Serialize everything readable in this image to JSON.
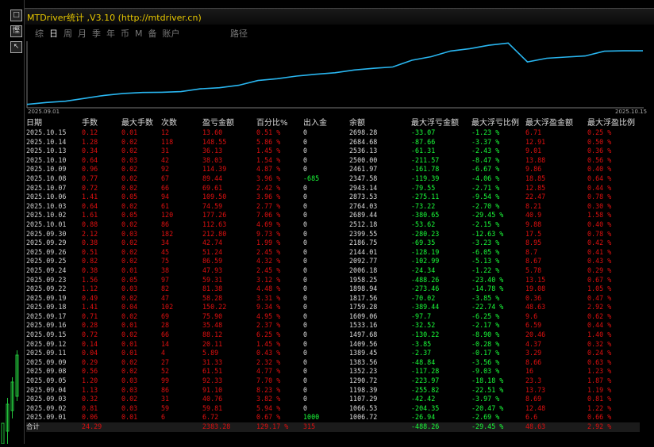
{
  "app": {
    "title": "MTDriver统计 ,V3.10 (http://mtdriver.cn)",
    "left_buttons": [
      "□",
      "慳",
      "↖"
    ]
  },
  "tabs": [
    "综",
    "日",
    "周",
    "月",
    "季",
    "年",
    "币",
    "M",
    "备",
    "账户"
  ],
  "active_tab": 1,
  "path_label": "路径",
  "equity_chart": {
    "type": "line",
    "line_color": "#29b6f0",
    "x_start_label": "2025.09.01",
    "x_end_label": "2025.10.15",
    "x": [
      "2025.09.01",
      "2025.09.02",
      "2025.09.03",
      "2025.09.04",
      "2025.09.05",
      "2025.09.08",
      "2025.09.09",
      "2025.09.10",
      "2025.09.11",
      "2025.09.12",
      "2025.09.15",
      "2025.09.16",
      "2025.09.17",
      "2025.09.18",
      "2025.09.19",
      "2025.09.22",
      "2025.09.23",
      "2025.09.24",
      "2025.09.25",
      "2025.09.26",
      "2025.09.29",
      "2025.09.30",
      "2025.10.01",
      "2025.10.02",
      "2025.10.03",
      "2025.10.06",
      "2025.10.07",
      "2025.10.08",
      "2025.10.09",
      "2025.10.10",
      "2025.10.13",
      "2025.10.14",
      "2025.10.15"
    ],
    "values": [
      1006.72,
      1066.53,
      1107.29,
      1198.39,
      1290.72,
      1352.23,
      1383.56,
      1389.45,
      1409.56,
      1497.68,
      1533.16,
      1609.06,
      1759.28,
      1817.56,
      1898.94,
      1958.25,
      2006.18,
      2092.77,
      2144.01,
      2186.75,
      2399.55,
      2512.18,
      2689.44,
      2764.03,
      2873.53,
      2943.14,
      2347.58,
      2461.97,
      2500.0,
      2536.13,
      2684.68,
      2698.28,
      2698.28
    ]
  },
  "table": {
    "headers": [
      "日期",
      "手数",
      "最大手数",
      "次数",
      "盈亏金额",
      "百分比%",
      "出入金",
      "余额",
      "最大浮亏金额",
      "最大浮亏比例",
      "最大浮盈金额",
      "最大浮盈比例"
    ],
    "rows": [
      [
        "2025.10.15",
        "0.12",
        "0.01",
        "12",
        "13.60",
        "0.51 %",
        "0",
        "2698.28",
        "-33.07",
        "-1.23 %",
        "6.71",
        "0.25 %"
      ],
      [
        "2025.10.14",
        "1.28",
        "0.02",
        "118",
        "148.55",
        "5.86 %",
        "0",
        "2684.68",
        "-87.66",
        "-3.37 %",
        "12.91",
        "0.50 %"
      ],
      [
        "2025.10.13",
        "0.34",
        "0.02",
        "31",
        "36.13",
        "1.45 %",
        "0",
        "2536.13",
        "-61.31",
        "-2.43 %",
        "9.01",
        "0.36 %"
      ],
      [
        "2025.10.10",
        "0.64",
        "0.03",
        "42",
        "38.03",
        "1.54 %",
        "0",
        "2500.00",
        "-211.57",
        "-8.47 %",
        "13.88",
        "0.56 %"
      ],
      [
        "2025.10.09",
        "0.96",
        "0.02",
        "92",
        "114.39",
        "4.87 %",
        "0",
        "2461.97",
        "-161.78",
        "-6.67 %",
        "9.86",
        "0.40 %"
      ],
      [
        "2025.10.08",
        "0.77",
        "0.02",
        "67",
        "89.44",
        "3.96 %",
        "-685",
        "2347.58",
        "-119.39",
        "-4.06 %",
        "18.85",
        "0.64 %"
      ],
      [
        "2025.10.07",
        "0.72",
        "0.02",
        "66",
        "69.61",
        "2.42 %",
        "0",
        "2943.14",
        "-79.55",
        "-2.71 %",
        "12.85",
        "0.44 %"
      ],
      [
        "2025.10.06",
        "1.41",
        "0.05",
        "94",
        "109.50",
        "3.96 %",
        "0",
        "2873.53",
        "-275.11",
        "-9.54 %",
        "22.47",
        "0.78 %"
      ],
      [
        "2025.10.03",
        "0.64",
        "0.02",
        "61",
        "74.59",
        "2.77 %",
        "0",
        "2764.03",
        "-73.22",
        "-2.70 %",
        "8.21",
        "0.30 %"
      ],
      [
        "2025.10.02",
        "1.61",
        "0.05",
        "120",
        "177.26",
        "7.06 %",
        "0",
        "2689.44",
        "-380.65",
        "-29.45 %",
        "40.9",
        "1.58 %"
      ],
      [
        "2025.10.01",
        "0.88",
        "0.02",
        "86",
        "112.63",
        "4.69 %",
        "0",
        "2512.18",
        "-53.62",
        "-2.15 %",
        "9.88",
        "0.40 %"
      ],
      [
        "2025.09.30",
        "2.12",
        "0.03",
        "182",
        "212.80",
        "9.73 %",
        "0",
        "2399.55",
        "-280.23",
        "-12.63 %",
        "17.5",
        "0.78 %"
      ],
      [
        "2025.09.29",
        "0.38",
        "0.02",
        "34",
        "42.74",
        "1.99 %",
        "0",
        "2186.75",
        "-69.35",
        "-3.23 %",
        "8.95",
        "0.42 %"
      ],
      [
        "2025.09.26",
        "0.51",
        "0.02",
        "45",
        "51.24",
        "2.45 %",
        "0",
        "2144.01",
        "-128.19",
        "-6.05 %",
        "8.7",
        "0.41 %"
      ],
      [
        "2025.09.25",
        "0.82",
        "0.02",
        "75",
        "86.59",
        "4.32 %",
        "0",
        "2092.77",
        "-102.99",
        "-5.13 %",
        "8.67",
        "0.43 %"
      ],
      [
        "2025.09.24",
        "0.38",
        "0.01",
        "38",
        "47.93",
        "2.45 %",
        "0",
        "2006.18",
        "-24.34",
        "-1.22 %",
        "5.78",
        "0.29 %"
      ],
      [
        "2025.09.23",
        "1.56",
        "0.05",
        "97",
        "59.31",
        "3.12 %",
        "0",
        "1958.25",
        "-488.26",
        "-23.40 %",
        "13.15",
        "0.67 %"
      ],
      [
        "2025.09.22",
        "1.12",
        "0.03",
        "82",
        "81.38",
        "4.48 %",
        "0",
        "1898.94",
        "-273.46",
        "-14.78 %",
        "19.08",
        "1.05 %"
      ],
      [
        "2025.09.19",
        "0.49",
        "0.02",
        "47",
        "58.28",
        "3.31 %",
        "0",
        "1817.56",
        "-70.02",
        "-3.85 %",
        "0.36",
        "0.47 %"
      ],
      [
        "2025.09.18",
        "1.41",
        "0.04",
        "102",
        "150.22",
        "9.34 %",
        "0",
        "1759.28",
        "-389.44",
        "-22.74 %",
        "48.63",
        "2.92 %"
      ],
      [
        "2025.09.17",
        "0.71",
        "0.02",
        "69",
        "75.90",
        "4.95 %",
        "0",
        "1609.06",
        "-97.7",
        "-6.25 %",
        "9.6",
        "0.62 %"
      ],
      [
        "2025.09.16",
        "0.28",
        "0.01",
        "28",
        "35.48",
        "2.37 %",
        "0",
        "1533.16",
        "-32.52",
        "-2.17 %",
        "6.59",
        "0.44 %"
      ],
      [
        "2025.09.15",
        "0.72",
        "0.02",
        "66",
        "88.12",
        "6.25 %",
        "0",
        "1497.68",
        "-130.22",
        "-8.90 %",
        "20.46",
        "1.40 %"
      ],
      [
        "2025.09.12",
        "0.14",
        "0.01",
        "14",
        "20.11",
        "1.45 %",
        "0",
        "1409.56",
        "-3.85",
        "-0.28 %",
        "4.37",
        "0.32 %"
      ],
      [
        "2025.09.11",
        "0.04",
        "0.01",
        "4",
        "5.89",
        "0.43 %",
        "0",
        "1389.45",
        "-2.37",
        "-0.17 %",
        "3.29",
        "0.24 %"
      ],
      [
        "2025.09.09",
        "0.29",
        "0.02",
        "27",
        "31.33",
        "2.32 %",
        "0",
        "1383.56",
        "-48.84",
        "-3.56 %",
        "8.66",
        "0.63 %"
      ],
      [
        "2025.09.08",
        "0.56",
        "0.02",
        "52",
        "61.51",
        "4.77 %",
        "0",
        "1352.23",
        "-117.28",
        "-9.03 %",
        "16",
        "1.23 %"
      ],
      [
        "2025.09.05",
        "1.20",
        "0.03",
        "99",
        "92.33",
        "7.70 %",
        "0",
        "1290.72",
        "-223.97",
        "-18.18 %",
        "23.3",
        "1.87 %"
      ],
      [
        "2025.09.04",
        "1.13",
        "0.03",
        "86",
        "91.10",
        "8.23 %",
        "0",
        "1198.39",
        "-255.82",
        "-22.51 %",
        "13.73",
        "1.19 %"
      ],
      [
        "2025.09.03",
        "0.32",
        "0.02",
        "31",
        "40.76",
        "3.82 %",
        "0",
        "1107.29",
        "-42.42",
        "-3.97 %",
        "8.69",
        "0.81 %"
      ],
      [
        "2025.09.02",
        "0.81",
        "0.03",
        "59",
        "59.81",
        "5.94 %",
        "0",
        "1066.53",
        "-204.35",
        "-20.47 %",
        "12.48",
        "1.22 %"
      ],
      [
        "2025.09.01",
        "0.06",
        "0.01",
        "6",
        "6.72",
        "0.67 %",
        "1000",
        "1006.72",
        "-26.94",
        "-2.69 %",
        "6.6",
        "0.66 %"
      ]
    ],
    "total": [
      "合计",
      "24.29",
      "",
      "",
      "2383.28",
      "129.17 %",
      "315",
      "",
      "-488.26",
      "-29.45 %",
      "48.63",
      "2.92 %"
    ]
  },
  "colors": {
    "background": "#000000",
    "title": "#e8c800",
    "positive": "#e01010",
    "negative": "#1aff3a",
    "text": "#dddddd",
    "line": "#29b6f0"
  }
}
